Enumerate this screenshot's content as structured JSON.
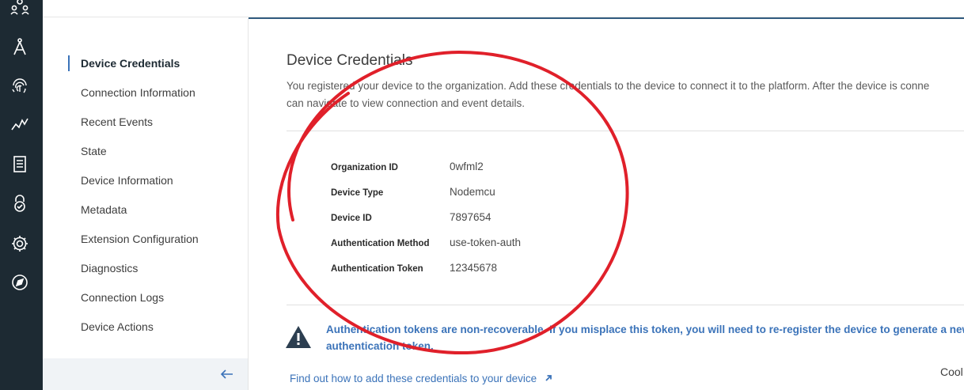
{
  "rail": {
    "icons": [
      "org-icon",
      "compass-draw-icon",
      "fingerprint-icon",
      "analytics-icon",
      "document-icon",
      "security-lock-icon",
      "settings-icon",
      "explore-icon"
    ]
  },
  "sidenav": {
    "items": [
      {
        "label": "Device Credentials",
        "active": true
      },
      {
        "label": "Connection Information",
        "active": false
      },
      {
        "label": "Recent Events",
        "active": false
      },
      {
        "label": "State",
        "active": false
      },
      {
        "label": "Device Information",
        "active": false
      },
      {
        "label": "Metadata",
        "active": false
      },
      {
        "label": "Extension Configuration",
        "active": false
      },
      {
        "label": "Diagnostics",
        "active": false
      },
      {
        "label": "Connection Logs",
        "active": false
      },
      {
        "label": "Device Actions",
        "active": false
      }
    ]
  },
  "main": {
    "title": "Device Credentials",
    "description_line1": "You registered your device to the organization. Add these credentials to the device to connect it to the platform. After the device is conne",
    "description_line2": "can navigate to view connection and event details.",
    "credentials": [
      {
        "label": "Organization ID",
        "value": "0wfml2"
      },
      {
        "label": "Device Type",
        "value": "Nodemcu"
      },
      {
        "label": "Device ID",
        "value": "7897654"
      },
      {
        "label": "Authentication Method",
        "value": "use-token-auth"
      },
      {
        "label": "Authentication Token",
        "value": "12345678"
      }
    ],
    "warning_line1": "Authentication tokens are non-recoverable. If you misplace this token, you will need to re-register the device to generate a new",
    "warning_line2": "authentication token.",
    "help_link": "Find out how to add these credentials to your device",
    "cool_text": "Cool"
  },
  "colors": {
    "rail_bg": "#1d2a33",
    "accent": "#3b73b9",
    "annotation": "#e0202a"
  }
}
